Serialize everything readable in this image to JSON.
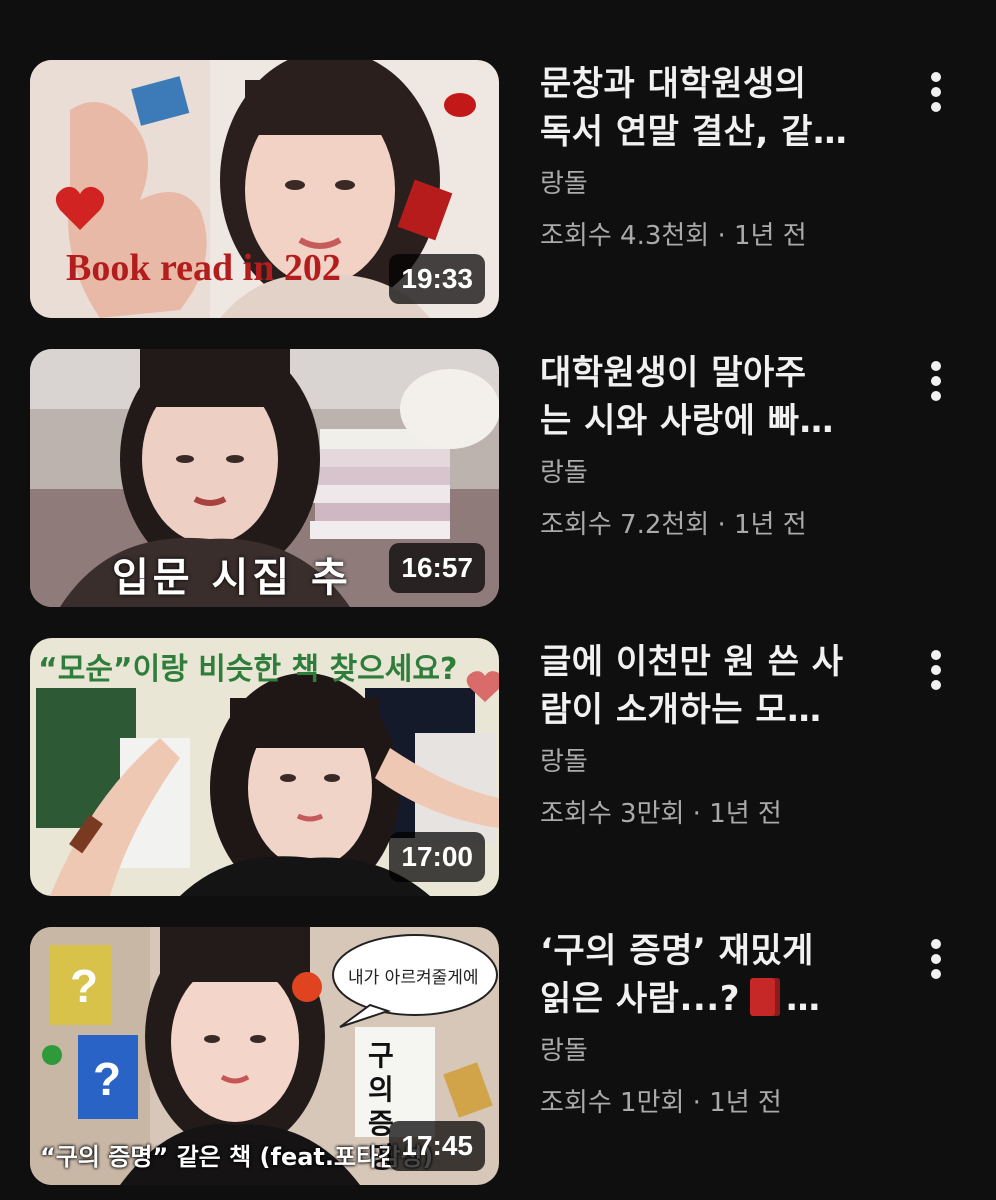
{
  "videos": [
    {
      "title_line1": "문창과 대학원생의",
      "title_line2": "독서 연말 결산, 같…",
      "channel": "랑돌",
      "stats": "조회수 4.3천회 · 1년 전",
      "duration": "19:33",
      "thumb_text": "Book read in 202"
    },
    {
      "title_line1": "대학원생이 말아주",
      "title_line2": "는 시와 사랑에 빠…",
      "channel": "랑돌",
      "stats": "조회수 7.2천회 · 1년 전",
      "duration": "16:57",
      "thumb_text": "입문 시집 추"
    },
    {
      "title_line1": "글에 이천만 원 쓴 사",
      "title_line2": "람이 소개하는 모…",
      "channel": "랑돌",
      "stats": "조회수 3만회 · 1년 전",
      "duration": "17:00",
      "thumb_text": "“모순”이랑 비슷한 책 찾으세요?"
    },
    {
      "title_line1": "‘구의 증명’ 재밌게",
      "title_line2": "읽은 사람...?",
      "title_line2_suffix": "…",
      "channel": "랑돌",
      "stats": "조회수 1만회 · 1년 전",
      "duration": "17:45",
      "thumb_text": "“구의 증명” 같은 책 (feat.포타감성)",
      "thumb_bubble": "내가 아르켜줄게에",
      "thumb_book_title": "구의 증명"
    }
  ],
  "icons": {
    "more": "more-vert-icon",
    "book": "red-book-emoji-icon"
  },
  "colors": {
    "background": "#0f0f0f",
    "title": "#f1f1f1",
    "secondary": "#aaaaaa"
  }
}
